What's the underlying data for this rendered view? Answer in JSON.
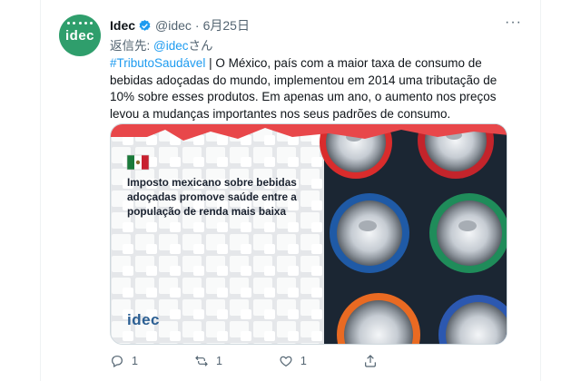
{
  "tweet": {
    "avatar_text": "idec",
    "name": "Idec",
    "handle": "@idec",
    "separator": "·",
    "date": "6月25日",
    "more_label": "···",
    "reply_prefix": "返信先: ",
    "reply_handle": "@idec",
    "reply_suffix": "さん",
    "hashtag": "#TributoSaudável",
    "text": " | O México, país com a maior taxa de consumo de bebidas adoçadas do mundo, implementou em 2014 uma tributação de 10% sobre esses produtos. Em apenas um ano, o aumento nos preços levou a mudanças importantes nos seus padrões de consumo."
  },
  "media": {
    "headline": "Imposto mexicano sobre bebidas adoçadas promove saúde entre a população de renda mais baixa",
    "logo_text": "idec",
    "accent_color": "#e8474a",
    "flag_colors": [
      "#1a7a3a",
      "#ffffff",
      "#c8202f"
    ]
  },
  "actions": {
    "replies": "1",
    "retweets": "1",
    "likes": "1",
    "share": ""
  },
  "colors": {
    "link": "#1d9bf0",
    "avatar_bg": "#2f9e6c",
    "secondary_text": "#536471"
  }
}
